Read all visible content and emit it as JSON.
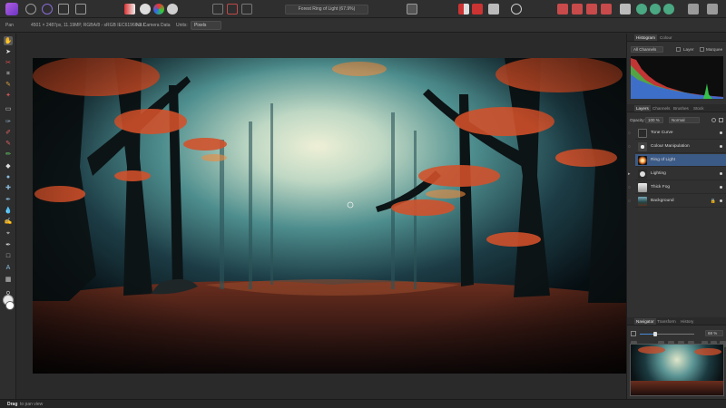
{
  "toolbar": {
    "document_title": "Forest Ring of Light (67.9%)"
  },
  "context_bar": {
    "tool_name": "Pan",
    "image_info": "4501 × 2487px, 11.19MP, RGBA/8 - sRGB IEC61966-2.1",
    "camera_data": "No Camera Data",
    "units_label": "Units:",
    "units_value": "Pixels"
  },
  "histogram_panel": {
    "tabs": [
      "Histogram",
      "Colour"
    ],
    "channel_select": "All Channels",
    "layer_option": "Layer",
    "marquee_option": "Marquee"
  },
  "layers_panel": {
    "tabs": [
      "Layers",
      "Channels",
      "Brushes",
      "Stock"
    ],
    "opacity_label": "Opacity:",
    "opacity_value": "100 %",
    "blend_mode": "Normal",
    "layers": [
      {
        "name": "Tone Curve"
      },
      {
        "name": "Colour Manipulation"
      },
      {
        "name": "Ring of Light"
      },
      {
        "name": "Lighting"
      },
      {
        "name": "Thick Fog"
      },
      {
        "name": "Background"
      }
    ]
  },
  "navigator_panel": {
    "tabs": [
      "Navigator",
      "Transform",
      "History"
    ],
    "zoom_value": "68 %"
  },
  "status": {
    "hint_bold": "Drag",
    "hint_text": "to pan view"
  },
  "colors": {
    "accent_selection": "#3c5a86",
    "app_brand": "#9b4fd6",
    "panel_bg": "#313131",
    "canvas_bg": "#2a2a2a"
  }
}
